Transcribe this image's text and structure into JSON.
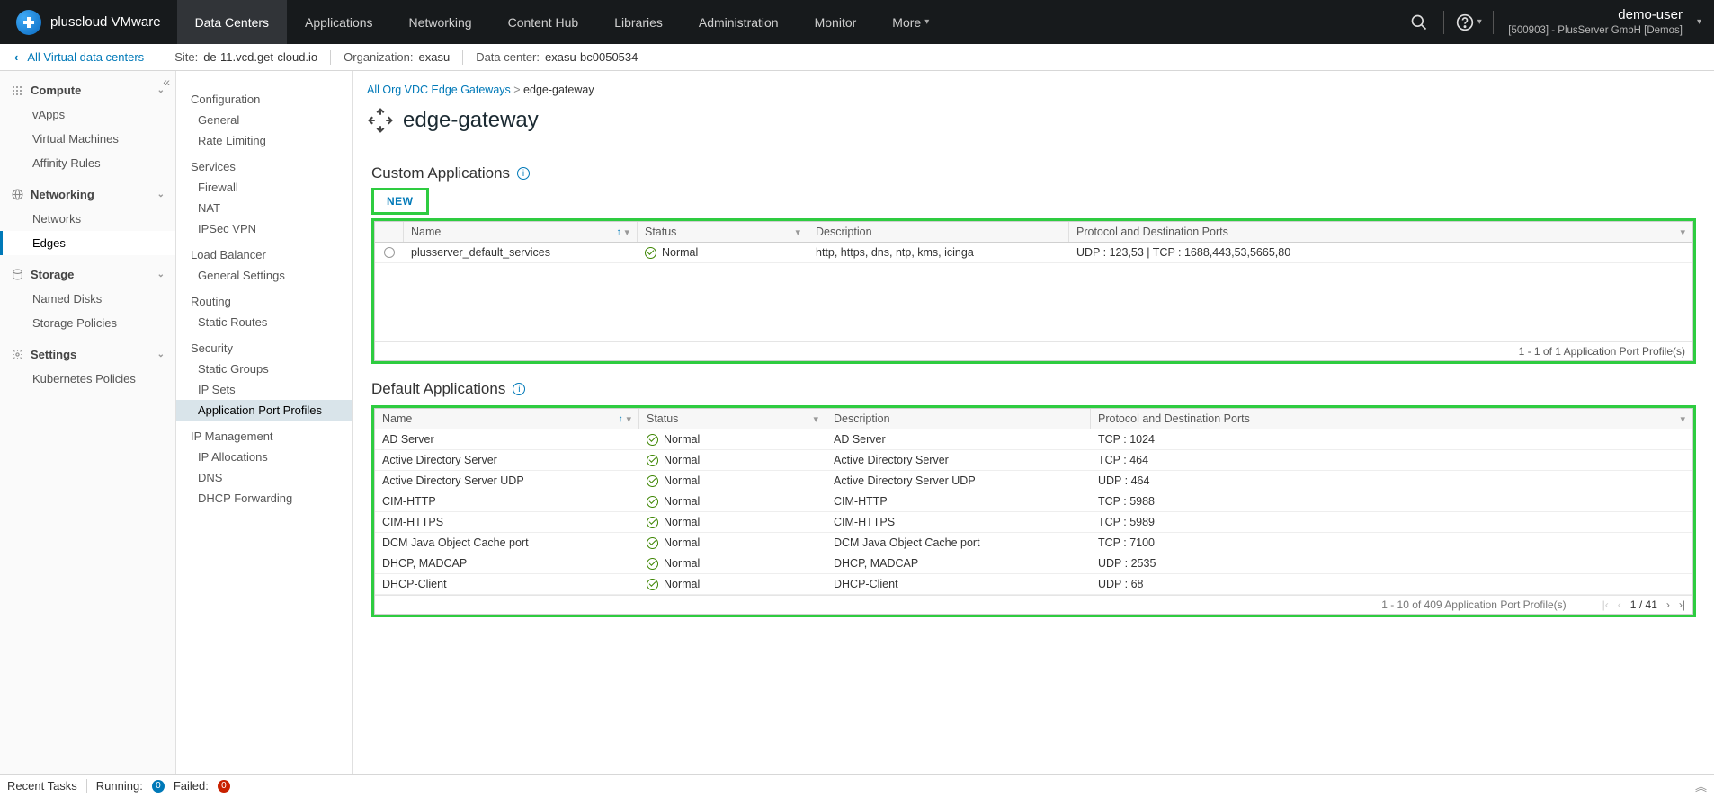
{
  "brand": "pluscloud VMware",
  "topnav": {
    "items": [
      "Data Centers",
      "Applications",
      "Networking",
      "Content Hub",
      "Libraries",
      "Administration",
      "Monitor",
      "More"
    ],
    "active": 0
  },
  "user": {
    "name": "demo-user",
    "org": "[500903] - PlusServer GmbH [Demos]"
  },
  "context": {
    "back_link": "All Virtual data centers",
    "site_label": "Site:",
    "site_value": "de-11.vcd.get-cloud.io",
    "org_label": "Organization:",
    "org_value": "exasu",
    "dc_label": "Data center:",
    "dc_value": "exasu-bc0050534"
  },
  "sidebar1": {
    "groups": [
      {
        "title": "Compute",
        "icon": "grid",
        "items": [
          "vApps",
          "Virtual Machines",
          "Affinity Rules"
        ]
      },
      {
        "title": "Networking",
        "icon": "globe",
        "items": [
          "Networks",
          "Edges"
        ],
        "active_item": 1
      },
      {
        "title": "Storage",
        "icon": "disk",
        "items": [
          "Named Disks",
          "Storage Policies"
        ]
      },
      {
        "title": "Settings",
        "icon": "gear",
        "items": [
          "Kubernetes Policies"
        ]
      }
    ]
  },
  "sidebar2": {
    "groups": [
      {
        "title": "Configuration",
        "items": [
          "General",
          "Rate Limiting"
        ]
      },
      {
        "title": "Services",
        "items": [
          "Firewall",
          "NAT",
          "IPSec VPN"
        ]
      },
      {
        "title": "Load Balancer",
        "items": [
          "General Settings"
        ]
      },
      {
        "title": "Routing",
        "items": [
          "Static Routes"
        ]
      },
      {
        "title": "Security",
        "items": [
          "Static Groups",
          "IP Sets",
          "Application Port Profiles"
        ],
        "active_item": 2
      },
      {
        "title": "IP Management",
        "items": [
          "IP Allocations",
          "DNS",
          "DHCP Forwarding"
        ]
      }
    ]
  },
  "breadcrumb": {
    "link": "All Org VDC Edge Gateways ",
    "current": "edge-gateway"
  },
  "page_title": "edge-gateway",
  "custom": {
    "heading": "Custom Applications",
    "new_btn": "NEW",
    "cols": {
      "name": "Name",
      "status": "Status",
      "desc": "Description",
      "proto": "Protocol and Destination Ports"
    },
    "rows": [
      {
        "name": "plusserver_default_services",
        "status": "Normal",
        "desc": "http, https, dns, ntp, kms, icinga",
        "proto": "UDP :  123,53 | TCP :  1688,443,53,5665,80"
      }
    ],
    "footer": "1 - 1 of 1 Application Port Profile(s)"
  },
  "defaults": {
    "heading": "Default Applications",
    "cols": {
      "name": "Name",
      "status": "Status",
      "desc": "Description",
      "proto": "Protocol and Destination Ports"
    },
    "rows": [
      {
        "name": "AD Server",
        "status": "Normal",
        "desc": "AD Server",
        "proto": "TCP :  1024"
      },
      {
        "name": "Active Directory Server",
        "status": "Normal",
        "desc": "Active Directory Server",
        "proto": "TCP :  464"
      },
      {
        "name": "Active Directory Server UDP",
        "status": "Normal",
        "desc": "Active Directory Server UDP",
        "proto": "UDP :  464"
      },
      {
        "name": "CIM-HTTP",
        "status": "Normal",
        "desc": "CIM-HTTP",
        "proto": "TCP :  5988"
      },
      {
        "name": "CIM-HTTPS",
        "status": "Normal",
        "desc": "CIM-HTTPS",
        "proto": "TCP :  5989"
      },
      {
        "name": "DCM Java Object Cache port",
        "status": "Normal",
        "desc": "DCM Java Object Cache port",
        "proto": "TCP :  7100"
      },
      {
        "name": "DHCP, MADCAP",
        "status": "Normal",
        "desc": "DHCP, MADCAP",
        "proto": "UDP :  2535"
      },
      {
        "name": "DHCP-Client",
        "status": "Normal",
        "desc": "DHCP-Client",
        "proto": "UDP :  68"
      }
    ],
    "footer_count": "1 - 10 of 409 Application Port Profile(s)",
    "pager": {
      "page": "1",
      "sep": "/",
      "total": "41"
    }
  },
  "tasks": {
    "title": "Recent Tasks",
    "running_label": "Running:",
    "running": "0",
    "failed_label": "Failed:",
    "failed": "0"
  }
}
